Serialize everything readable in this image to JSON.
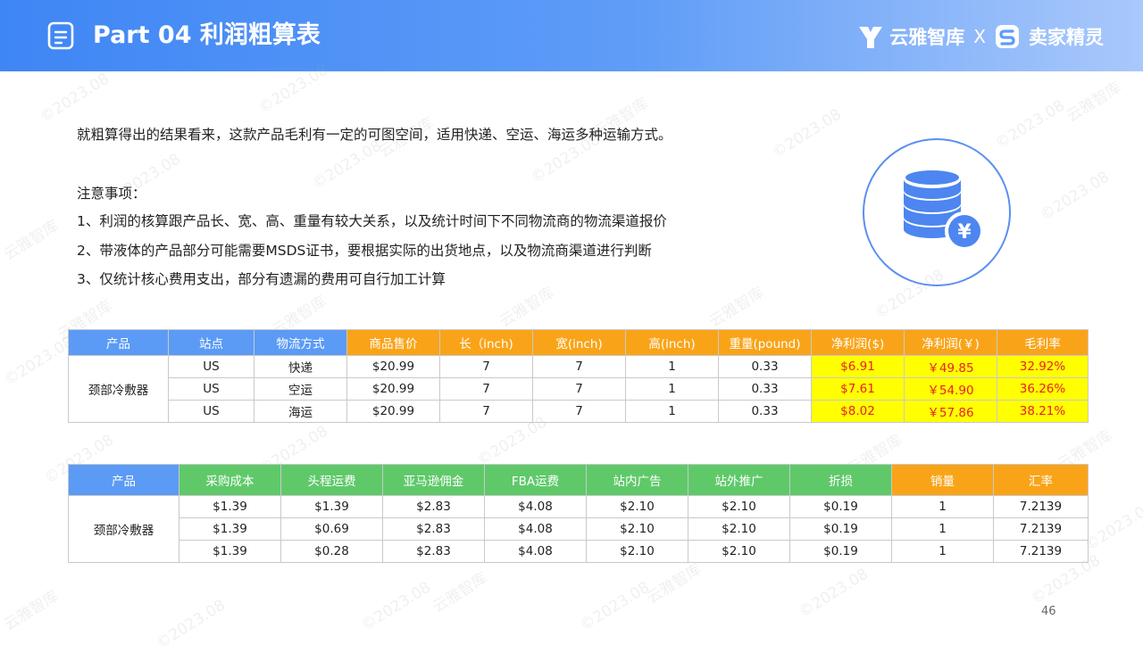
{
  "header": {
    "title": "Part 04 利润粗算表",
    "brand_left": "云雅智库",
    "brand_sep": "X",
    "brand_right": "卖家精灵"
  },
  "watermarks": [
    "©2023.08",
    "云雅智库"
  ],
  "intro": "就粗算得出的结果看来，这款产品毛利有一定的可图空间，适用快递、空运、海运多种运输方式。",
  "notes_title": "注意事项：",
  "notes": [
    "1、利润的核算跟产品长、宽、高、重量有较大关系，以及统计时间下不同物流商的物流渠道报价",
    "2、带液体的产品部分可能需要MSDS证书，要根据实际的出货地点，以及物流商渠道进行判断",
    "3、仅统计核心费用支出，部分有遗漏的费用可自行加工计算"
  ],
  "colors": {
    "header_blue": "#3f86f5",
    "col_blue": "#5b9bf5",
    "col_orange": "#f9a418",
    "col_green": "#5fc96a",
    "highlight_yellow": "#ffff00",
    "highlight_text_red": "#e8202a"
  },
  "table1": {
    "headers": [
      "产品",
      "站点",
      "物流方式",
      "商品售价",
      "长（inch)",
      "宽(inch)",
      "高(inch)",
      "重量(pound)",
      "净利润($)",
      "净利润(￥)",
      "毛利率"
    ],
    "product": "颈部冷敷器",
    "rows": [
      [
        "US",
        "快递",
        "$20.99",
        "7",
        "7",
        "1",
        "0.33",
        "$6.91",
        "￥49.85",
        "32.92%"
      ],
      [
        "US",
        "空运",
        "$20.99",
        "7",
        "7",
        "1",
        "0.33",
        "$7.61",
        "￥54.90",
        "36.26%"
      ],
      [
        "US",
        "海运",
        "$20.99",
        "7",
        "7",
        "1",
        "0.33",
        "$8.02",
        "￥57.86",
        "38.21%"
      ]
    ]
  },
  "table2": {
    "headers": [
      "产品",
      "采购成本",
      "头程运费",
      "亚马逊佣金",
      "FBA运费",
      "站内广告",
      "站外推广",
      "折损",
      "销量",
      "汇率"
    ],
    "product": "颈部冷敷器",
    "rows": [
      [
        "$1.39",
        "$1.39",
        "$2.83",
        "$4.08",
        "$2.10",
        "$2.10",
        "$0.19",
        "1",
        "7.2139"
      ],
      [
        "$1.39",
        "$0.69",
        "$2.83",
        "$4.08",
        "$2.10",
        "$2.10",
        "$0.19",
        "1",
        "7.2139"
      ],
      [
        "$1.39",
        "$0.28",
        "$2.83",
        "$4.08",
        "$2.10",
        "$2.10",
        "$0.19",
        "1",
        "7.2139"
      ]
    ]
  },
  "coin_icon": {
    "name": "money-coins-icon",
    "symbol": "¥"
  },
  "page_number": "46"
}
